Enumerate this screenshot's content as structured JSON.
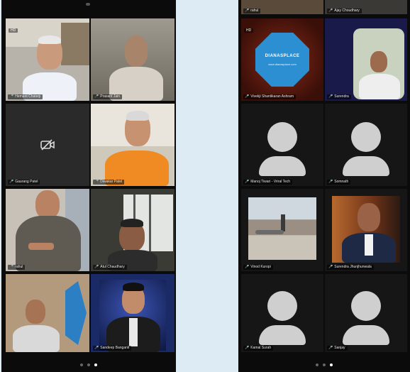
{
  "left_panel": {
    "tiles": [
      {
        "label": "Hemant Chaterji",
        "badge": "HD",
        "active": false
      },
      {
        "label": "Prasant Jain",
        "badge": "",
        "active": true
      },
      {
        "label": "Gaurang Patel",
        "badge": "",
        "video_off": true,
        "active": false
      },
      {
        "label": "Diwakar Patel",
        "badge": "",
        "active": false
      },
      {
        "label": "rahul",
        "badge": "",
        "active": false
      },
      {
        "label": "Atul Chaudhary",
        "badge": "",
        "active": false
      },
      {
        "label": "",
        "badge": "",
        "active": false
      },
      {
        "label": "Sandeep Banganli",
        "badge": "",
        "active": false
      }
    ],
    "top_labels": []
  },
  "right_panel": {
    "top_labels": [
      "rahul",
      "Ajay Choudhary"
    ],
    "tiles": [
      {
        "label": "Vivekji Shantikaran Ashram",
        "badge": "HD",
        "logo": "DIANASPLACE",
        "logo_sub": "www.dianasplace.com",
        "active": false
      },
      {
        "label": "Surendra",
        "badge": "",
        "active": false
      },
      {
        "label": "Manoj Tiwari - Vriral Tech",
        "badge": "",
        "placeholder": true,
        "active": false
      },
      {
        "label": "Somnath",
        "badge": "",
        "placeholder": true,
        "active": false
      },
      {
        "label": "Vinod Kuropi",
        "badge": "",
        "active": false
      },
      {
        "label": "Surendra Jhunjhunwala",
        "badge": "",
        "active": false
      },
      {
        "label": "Kamal Surah",
        "badge": "",
        "placeholder": true,
        "active": false
      },
      {
        "label": "Sanjay",
        "badge": "",
        "placeholder": true,
        "active": false
      }
    ]
  },
  "pager": {
    "pages": 3,
    "current": 3
  },
  "icons": {
    "mic_muted": "mic-muted-icon",
    "video_off": "video-off-icon"
  },
  "colors": {
    "active_border": "#3fbf3f",
    "mute_red": "#ff3b30"
  }
}
